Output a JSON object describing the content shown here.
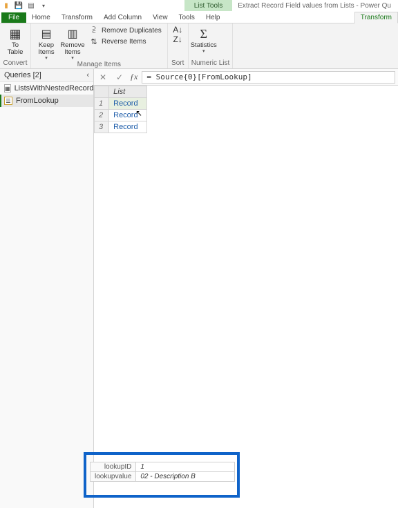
{
  "titlebar": {
    "context_tool_label": "List Tools",
    "window_title": "Extract Record Field values from Lists - Power Qu"
  },
  "ribbon": {
    "tabs": {
      "file": "File",
      "home": "Home",
      "transform": "Transform",
      "add_column": "Add Column",
      "view": "View",
      "tools": "Tools",
      "help": "Help",
      "context_transform": "Transform"
    },
    "convert": {
      "to_table": "To\nTable",
      "group": "Convert"
    },
    "manage": {
      "keep": "Keep\nItems",
      "remove": "Remove\nItems",
      "remove_dup": "Remove Duplicates",
      "reverse": "Reverse Items",
      "group": "Manage Items"
    },
    "sort": {
      "group": "Sort"
    },
    "numeric": {
      "stats": "Statistics",
      "group": "Numeric List"
    }
  },
  "queries": {
    "header": "Queries [2]",
    "items": [
      {
        "label": "ListsWithNestedRecords"
      },
      {
        "label": "FromLookup"
      }
    ]
  },
  "formula": {
    "value": "= Source{0}[FromLookup]"
  },
  "grid": {
    "col_header": "List",
    "rows": [
      {
        "n": "1",
        "v": "Record"
      },
      {
        "n": "2",
        "v": "Record"
      },
      {
        "n": "3",
        "v": "Record"
      }
    ]
  },
  "record_detail": {
    "fields": [
      {
        "k": "lookupID",
        "v": "1"
      },
      {
        "k": "lookupvalue",
        "v": "02 - Description B"
      }
    ]
  }
}
